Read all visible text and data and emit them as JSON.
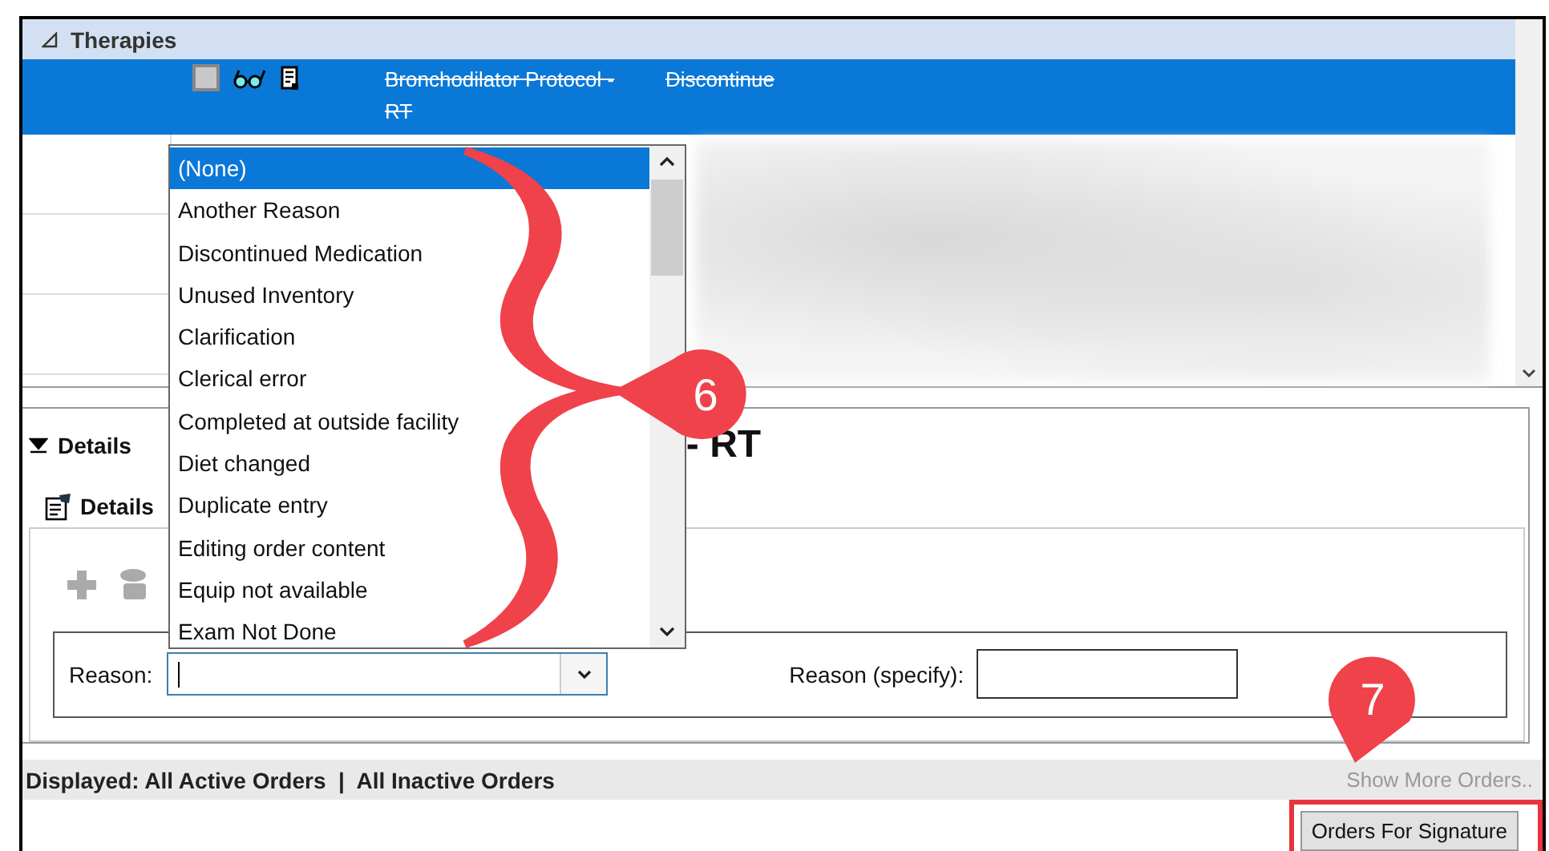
{
  "therapies": {
    "title": "Therapies",
    "expanded": true,
    "rows": [
      {
        "selected": true,
        "checked": false,
        "name": "Bronchodilator Protocol - RT",
        "status": "Discontinue"
      }
    ]
  },
  "details": {
    "title": "Details",
    "expanded": true,
    "heading": "- RT",
    "tab": "Details",
    "reason": {
      "label": "Reason:"
    },
    "reason_specify": {
      "label": "Reason (specify):"
    }
  },
  "reason_dropdown": {
    "items": [
      {
        "label": "(None)",
        "selected": true
      },
      {
        "label": "Another Reason",
        "selected": false
      },
      {
        "label": "Discontinued Medication",
        "selected": false
      },
      {
        "label": "Unused Inventory",
        "selected": false
      },
      {
        "label": "Clarification",
        "selected": false
      },
      {
        "label": "Clerical error",
        "selected": false
      },
      {
        "label": "Completed at outside facility",
        "selected": false
      },
      {
        "label": "Diet changed",
        "selected": false
      },
      {
        "label": "Duplicate entry",
        "selected": false
      },
      {
        "label": "Editing order content",
        "selected": false
      },
      {
        "label": "Equip not available",
        "selected": false
      },
      {
        "label": "Exam Not Done",
        "selected": false
      }
    ]
  },
  "status_bar": {
    "text": "Displayed: All Active Orders  |  All Inactive Orders",
    "show_more": "Show More Orders.."
  },
  "sign_button": "Orders For Signature",
  "callouts": [
    "6",
    "7"
  ]
}
